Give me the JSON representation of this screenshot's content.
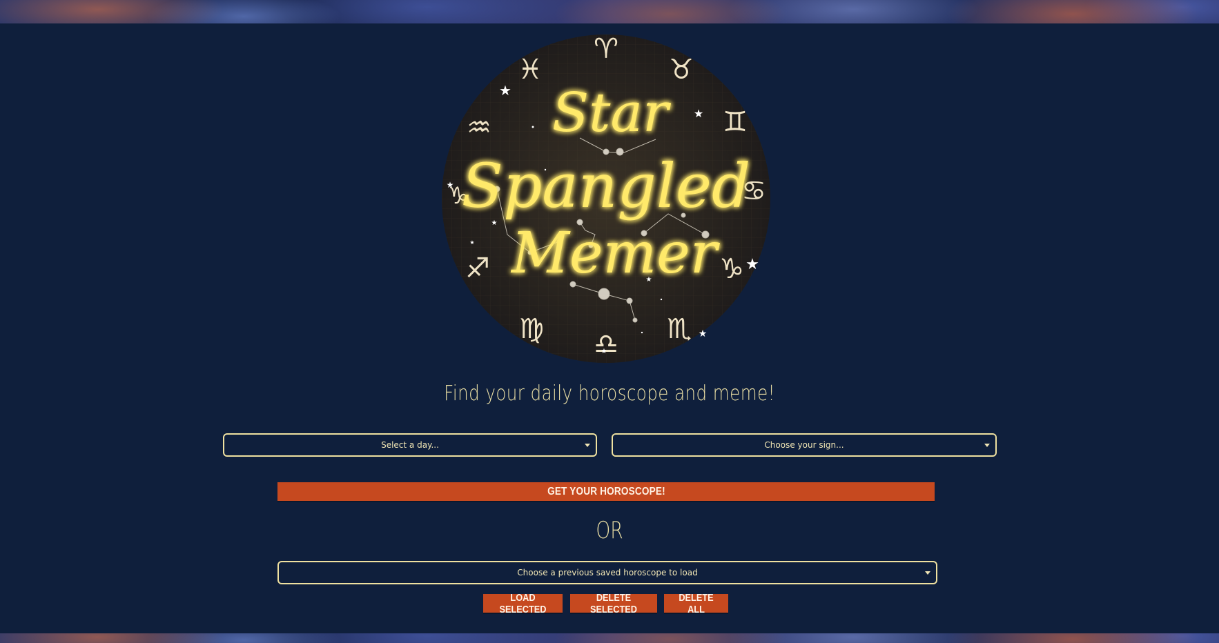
{
  "logo": {
    "lines": [
      "Star",
      "Spangled",
      "Memer"
    ]
  },
  "tagline": "Find your daily horoscope and meme!",
  "selectors": {
    "day_placeholder": "Select a day...",
    "sign_placeholder": "Choose your sign...",
    "saved_placeholder": "Choose a previous saved horoscope to load"
  },
  "buttons": {
    "get_horoscope": "Get your horoscope!",
    "load_selected": "Load selected",
    "delete_selected": "Delete selected",
    "delete_all": "Delete all"
  },
  "or_text": "OR",
  "colors": {
    "background": "#0f1f3c",
    "accent_orange": "#c6491f",
    "border_cream": "#efe1a0",
    "neon_yellow": "#ffe96a"
  }
}
